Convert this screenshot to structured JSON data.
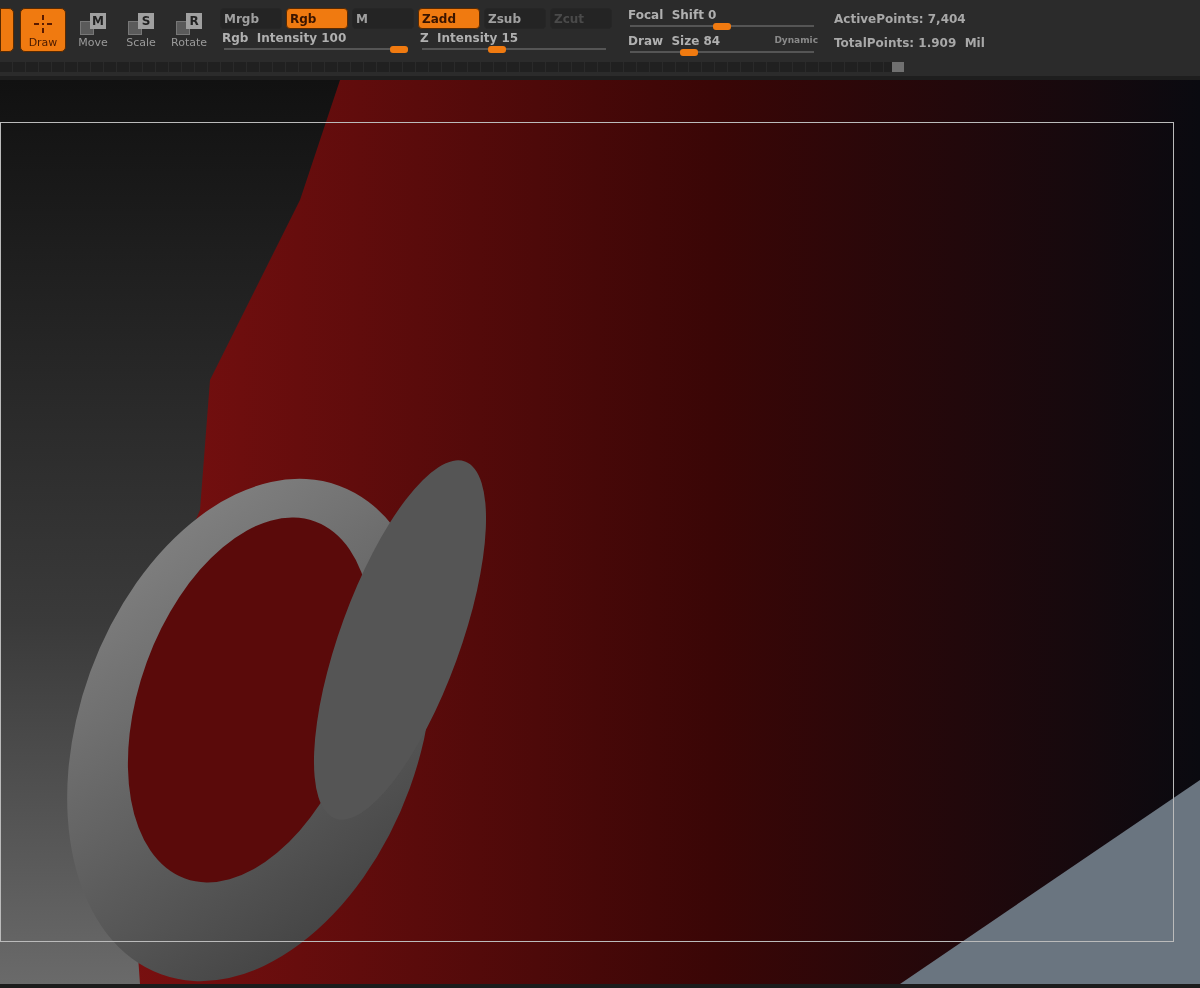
{
  "tools": [
    {
      "label": "Draw",
      "selected": true
    },
    {
      "label": "Move",
      "key_letter": "M",
      "selected": false
    },
    {
      "label": "Scale",
      "key_letter": "S",
      "selected": false
    },
    {
      "label": "Rotate",
      "key_letter": "R",
      "selected": false
    }
  ],
  "color_modes": [
    {
      "label": "Mrgb",
      "selected": false,
      "disabled": false
    },
    {
      "label": "Rgb",
      "selected": true,
      "disabled": false
    },
    {
      "label": "M",
      "selected": false,
      "disabled": false
    }
  ],
  "depth_modes": [
    {
      "label": "Zadd",
      "selected": true,
      "disabled": false
    },
    {
      "label": "Zsub",
      "selected": false,
      "disabled": false
    },
    {
      "label": "Zcut",
      "selected": false,
      "disabled": true
    }
  ],
  "sliders": [
    {
      "label": "Rgb  Intensity",
      "value": "100",
      "level": 1.0
    },
    {
      "label": "Z  Intensity",
      "value": "15",
      "level": 0.4
    },
    {
      "label": "Focal  Shift",
      "value": "0",
      "level": 0.5
    },
    {
      "label": "Draw  Size",
      "value": "84",
      "level": 0.3
    }
  ],
  "dynamic_label": "Dynamic",
  "stats": [
    {
      "label": "ActivePoints:",
      "value": "7,404"
    },
    {
      "label": "TotalPoints:",
      "value": "1.909  Mil"
    }
  ]
}
